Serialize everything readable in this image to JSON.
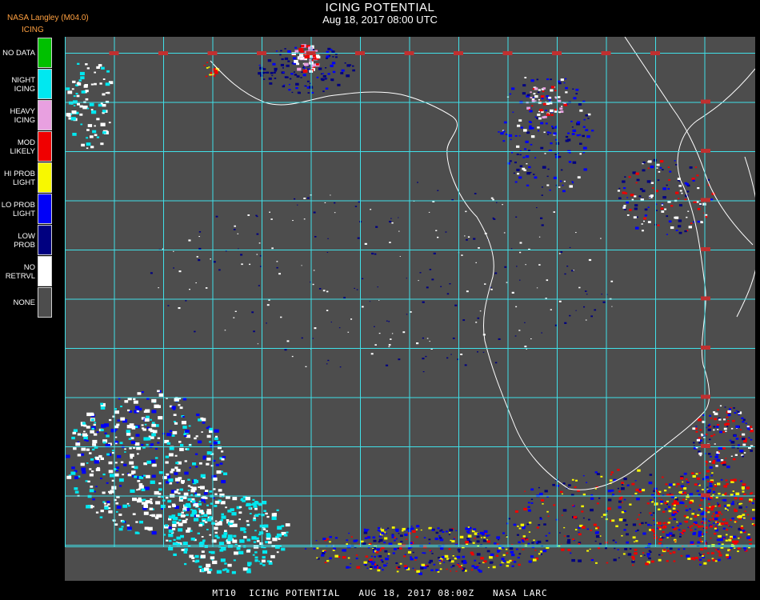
{
  "header": {
    "title": "ICING POTENTIAL",
    "datetime": "Aug 18, 2017 08:00 UTC",
    "credit": "NASA Langley (M04.0)"
  },
  "legend": {
    "title": "ICING",
    "items": [
      {
        "lines": [
          "NO DATA"
        ],
        "color": "#00c000"
      },
      {
        "lines": [
          "NIGHT",
          "ICING"
        ],
        "color": "#00e8f0"
      },
      {
        "lines": [
          "HEAVY",
          "ICING"
        ],
        "color": "#e8a0e0"
      },
      {
        "lines": [
          "MOD",
          "LIKELY"
        ],
        "color": "#f00000"
      },
      {
        "lines": [
          "HI PROB",
          "LIGHT"
        ],
        "color": "#f8f800"
      },
      {
        "lines": [
          "LO PROB",
          "LIGHT"
        ],
        "color": "#0000f8"
      },
      {
        "lines": [
          "LOW",
          "PROB"
        ],
        "color": "#000080"
      },
      {
        "lines": [
          "NO",
          "RETRVL"
        ],
        "color": "#ffffff"
      },
      {
        "lines": [
          "NONE"
        ],
        "color": "#4d4d4d"
      }
    ]
  },
  "footer": {
    "text": "MT10  ICING POTENTIAL   AUG 18, 2017 08:00Z   NASA LARC"
  },
  "colors": {
    "map_background": "#4d4d4d",
    "grid": "#40e0e8",
    "coastline": "#ffffff",
    "grid_label": "#c03030"
  }
}
